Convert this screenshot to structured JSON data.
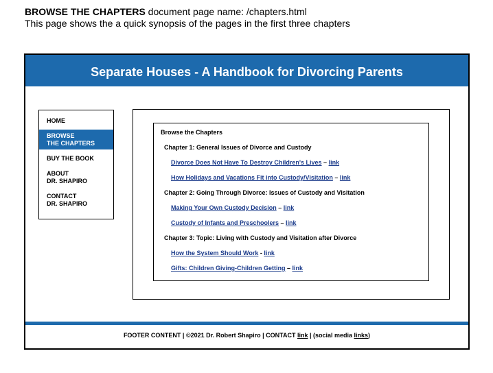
{
  "caption": {
    "title_bold": "BROWSE THE CHAPTERS",
    "title_rest": " document page name: /chapters.html",
    "line2": "This page shows the a quick synopsis of the pages in the first three chapters"
  },
  "header": {
    "title": "Separate Houses - A Handbook for Divorcing Parents"
  },
  "nav": {
    "home": "HOME",
    "browse_l1": "BROWSE",
    "browse_l2": "THE CHAPTERS",
    "buy": "BUY THE BOOK",
    "about_l1": "ABOUT",
    "about_l2": "DR. SHAPIRO",
    "contact_l1": "CONTACT",
    "contact_l2": "DR. SHAPIRO"
  },
  "content": {
    "title": "Browse the Chapters",
    "ch1": "Chapter 1: General Issues of Divorce and Custody",
    "ch1_e1": "Divorce Does Not Have To Destroy Children's Lives",
    "ch1_e1_sep": " – ",
    "ch1_e2": "How Holidays and Vacations Fit into Custody/Visitation",
    "ch1_e2_sep": " – ",
    "ch2": "Chapter 2: Going Through Divorce: Issues of Custody and Visitation",
    "ch2_e1": "Making Your Own Custody Decision",
    "ch2_e1_sep": " – ",
    "ch2_e2": "Custody of Infants and Preschoolers",
    "ch2_e2_sep": " – ",
    "ch3": "Chapter 3:  Topic: Living with Custody and Visitation after Divorce",
    "ch3_e1": "How the System Should Work",
    "ch3_e1_sep": " - ",
    "ch3_e2": "Gifts: Children Giving-Children Getting",
    "ch3_e2_sep": " – ",
    "link": "link"
  },
  "footer": {
    "text1": "FOOTER CONTENT  |  ©2021 Dr. Robert Shapiro  |  CONTACT ",
    "link1": "link",
    "text2": "  |    (social media ",
    "link2": "links",
    "text3": ")"
  },
  "colors": {
    "brand_blue": "#1d6aad",
    "link_blue": "#1a3a8a"
  }
}
